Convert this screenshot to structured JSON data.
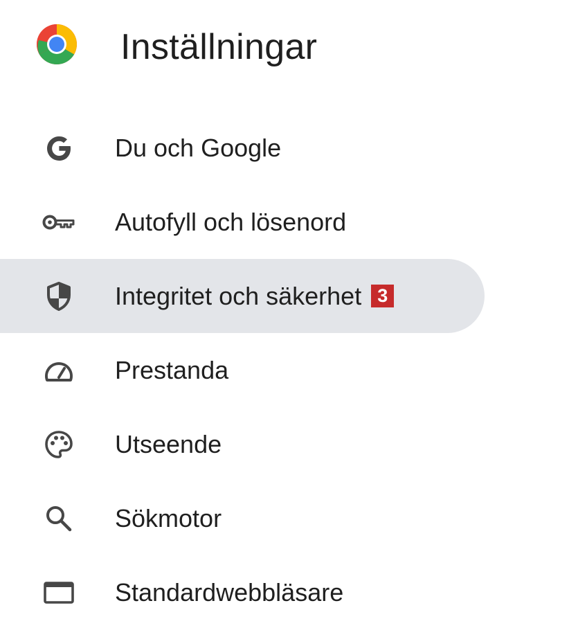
{
  "header": {
    "title": "Inställningar",
    "logo_icon": "chrome-logo-icon"
  },
  "nav": {
    "items": [
      {
        "label": "Du och Google",
        "icon": "google-g-icon",
        "active": false
      },
      {
        "label": "Autofyll och lösenord",
        "icon": "key-icon",
        "active": false
      },
      {
        "label": "Integritet och säkerhet",
        "icon": "shield-icon",
        "active": true,
        "badge": "3"
      },
      {
        "label": "Prestanda",
        "icon": "speedometer-icon",
        "active": false
      },
      {
        "label": "Utseende",
        "icon": "palette-icon",
        "active": false
      },
      {
        "label": "Sökmotor",
        "icon": "search-icon",
        "active": false
      },
      {
        "label": "Standardwebbläsare",
        "icon": "browser-window-icon",
        "active": false
      }
    ]
  },
  "colors": {
    "active_background": "#e3e5e9",
    "icon_color": "#474747",
    "badge_background": "#c62b2b",
    "text": "#1f1f1f"
  }
}
